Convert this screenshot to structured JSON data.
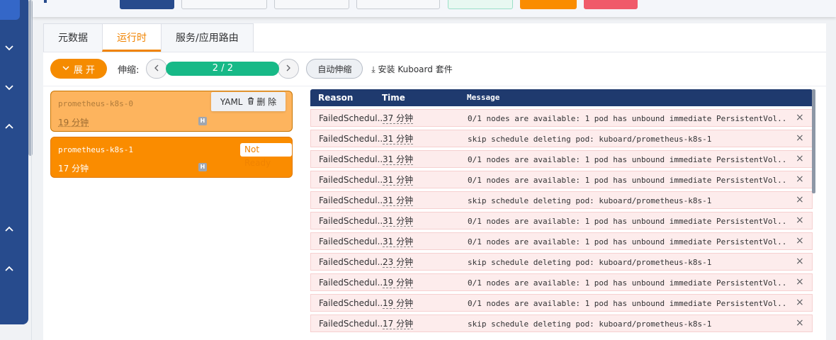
{
  "main": {
    "tabs": [
      {
        "label": "元数据"
      },
      {
        "label": "运行时"
      },
      {
        "label": "服务/应用路由"
      }
    ],
    "active_tab": "运行时",
    "controls": {
      "expand_label": "展 开",
      "scale_label": "伸缩:",
      "scale_value": "2 / 2",
      "auto_scale_label": "自动伸缩",
      "install_label": "安装 Kuboard 套件"
    },
    "pods": [
      {
        "name": "prometheus-k8s-0",
        "age": "19 分钟",
        "badge": "H",
        "actions": {
          "yaml": "YAML",
          "delete": "删 除"
        }
      },
      {
        "name": "prometheus-k8s-1",
        "age": "17 分钟",
        "badge": "H",
        "status": "Not Ready"
      }
    ],
    "events": {
      "columns": {
        "reason": "Reason",
        "time": "Time",
        "message": "Message"
      },
      "rows": [
        {
          "reason": "FailedSchedul...",
          "time": "37 分钟",
          "message": "0/1 nodes are available: 1 pod has unbound immediate PersistentVol..."
        },
        {
          "reason": "FailedSchedul...",
          "time": "31 分钟",
          "message": "skip schedule deleting pod: kuboard/prometheus-k8s-1"
        },
        {
          "reason": "FailedSchedul...",
          "time": "31 分钟",
          "message": "0/1 nodes are available: 1 pod has unbound immediate PersistentVol..."
        },
        {
          "reason": "FailedSchedul...",
          "time": "31 分钟",
          "message": "0/1 nodes are available: 1 pod has unbound immediate PersistentVol..."
        },
        {
          "reason": "FailedSchedul...",
          "time": "31 分钟",
          "message": "skip schedule deleting pod: kuboard/prometheus-k8s-1"
        },
        {
          "reason": "FailedSchedul...",
          "time": "31 分钟",
          "message": "0/1 nodes are available: 1 pod has unbound immediate PersistentVol..."
        },
        {
          "reason": "FailedSchedul...",
          "time": "31 分钟",
          "message": "0/1 nodes are available: 1 pod has unbound immediate PersistentVol..."
        },
        {
          "reason": "FailedSchedul...",
          "time": "23 分钟",
          "message": "skip schedule deleting pod: kuboard/prometheus-k8s-1"
        },
        {
          "reason": "FailedSchedul...",
          "time": "19 分钟",
          "message": "0/1 nodes are available: 1 pod has unbound immediate PersistentVol..."
        },
        {
          "reason": "FailedSchedul...",
          "time": "19 分钟",
          "message": "0/1 nodes are available: 1 pod has unbound immediate PersistentVol..."
        },
        {
          "reason": "FailedSchedul...",
          "time": "17 分钟",
          "message": "skip schedule deleting pod: kuboard/prometheus-k8s-1"
        }
      ]
    }
  },
  "colors": {
    "accent": "#f58b00",
    "sidebar": "#274b8d",
    "scale_bar": "#17b987",
    "event_header": "#1f3a6e",
    "event_row": "#fdecec"
  }
}
